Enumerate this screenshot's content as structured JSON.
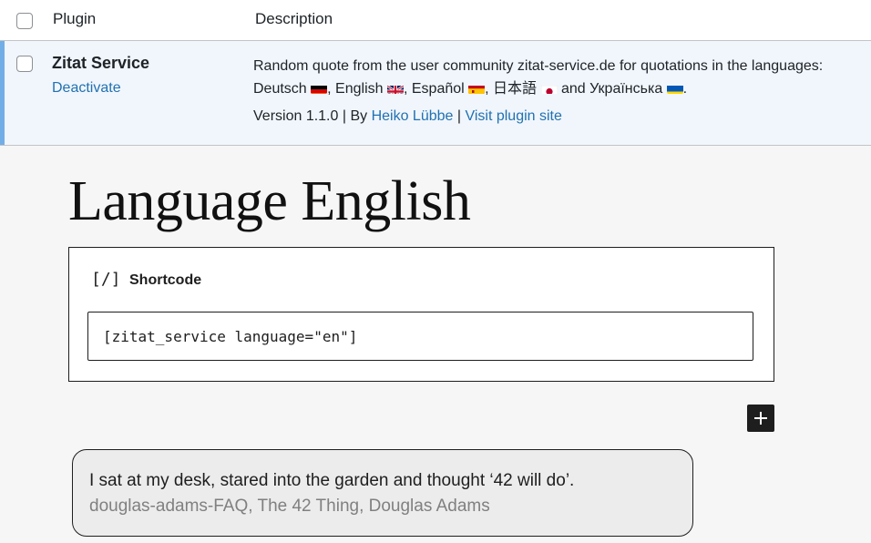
{
  "plugins_table": {
    "header": {
      "plugin": "Plugin",
      "description": "Description"
    },
    "row": {
      "name": "Zitat Service",
      "action": "Deactivate",
      "description": {
        "line1": "Random quote from the user community zitat-service.de for quotations in the languages:",
        "languages": [
          {
            "name": "Deutsch",
            "flag": "de",
            "suffix": ", "
          },
          {
            "name": "English",
            "flag": "gb",
            "suffix": ", "
          },
          {
            "name": "Español",
            "flag": "es",
            "suffix": ", "
          },
          {
            "name": "日本語",
            "flag": "jp",
            "suffix": " and "
          },
          {
            "name": "Українська",
            "flag": "ua",
            "suffix": "."
          }
        ]
      },
      "version": "Version 1.1.0",
      "separator1": " | By ",
      "author": "Heiko Lübbe",
      "separator2": " | ",
      "site_link": "Visit plugin site"
    },
    "colors": {
      "accent": "#72aee6",
      "link": "#2271b1",
      "row_bg": "#f0f6fc"
    }
  },
  "editor": {
    "title": "Language English",
    "shortcode_block": {
      "icon": "[/]",
      "label": "Shortcode",
      "value": "[zitat_service language=\"en\"]"
    },
    "add_block_icon": "plus-icon",
    "quote": {
      "text": "I sat at my desk, stared into the garden and thought ‘42 will do’.",
      "source": "douglas-adams-FAQ, The 42 Thing, Douglas Adams"
    }
  }
}
